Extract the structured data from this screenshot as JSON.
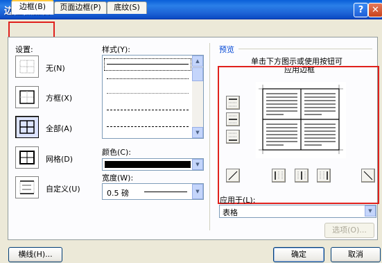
{
  "window": {
    "title": "边框和底纹",
    "help_glyph": "?",
    "close_glyph": "✕"
  },
  "tabs": [
    {
      "label": "边框(B)",
      "active": true
    },
    {
      "label": "页面边框(P)",
      "active": false
    },
    {
      "label": "底纹(S)",
      "active": false
    }
  ],
  "settings": {
    "heading": "设置:",
    "items": [
      {
        "label": "无(N)",
        "icon": "border-none-icon",
        "selected": false
      },
      {
        "label": "方框(X)",
        "icon": "border-box-icon",
        "selected": false
      },
      {
        "label": "全部(A)",
        "icon": "border-all-icon",
        "selected": true
      },
      {
        "label": "网格(D)",
        "icon": "border-grid-icon",
        "selected": false
      },
      {
        "label": "自定义(U)",
        "icon": "border-custom-icon",
        "selected": false
      }
    ]
  },
  "style": {
    "label": "样式(Y):",
    "options": [
      "solid",
      "dotted",
      "dotted-fine",
      "dashed",
      "dash-dot"
    ]
  },
  "color": {
    "label": "颜色(C):",
    "value": "#000000"
  },
  "width": {
    "label": "宽度(W):",
    "value": "0.5 磅"
  },
  "preview": {
    "heading": "预览",
    "hint_line1": "单击下方图示或使用按钮可",
    "hint_line2": "应用边框"
  },
  "apply_to": {
    "label": "应用于(L):",
    "value": "表格"
  },
  "buttons": {
    "options": "选项(O)...",
    "horizontal_line": "横线(H)...",
    "ok": "确定",
    "cancel": "取消"
  },
  "colors": {
    "highlight_red": "#e0201c",
    "title_blue": "#0a5fd8"
  }
}
